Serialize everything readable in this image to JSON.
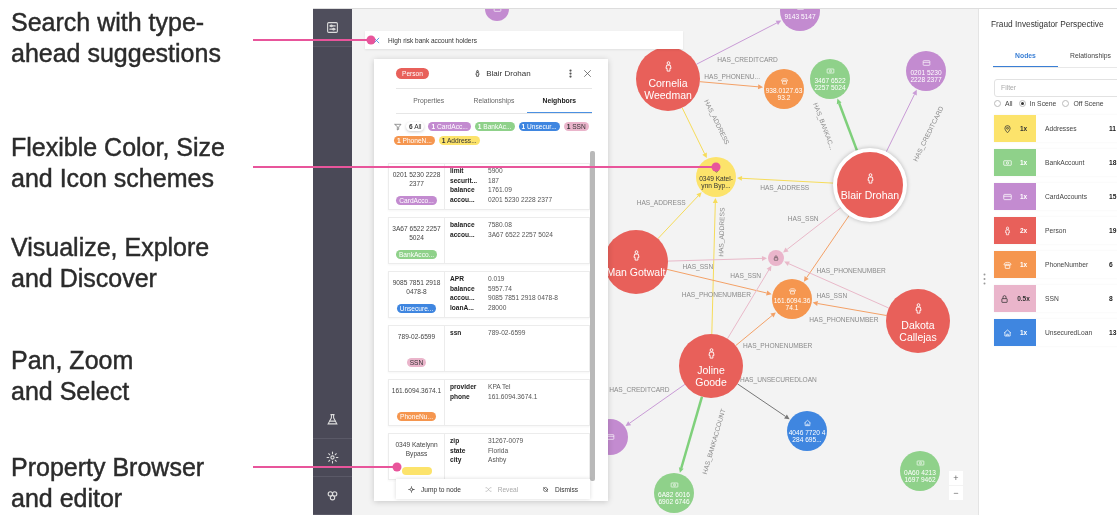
{
  "captions": [
    {
      "lines": [
        "Search with type-",
        "ahead suggestions"
      ],
      "leader": true
    },
    {
      "lines": [
        "Flexible Color, Size",
        "and Icon schemes"
      ],
      "leader": true
    },
    {
      "lines": [
        "Visualize, Explore",
        "and Discover"
      ]
    },
    {
      "lines": [
        "Pan, Zoom",
        "and Select"
      ]
    },
    {
      "lines": [
        "Property Browser",
        "and editor"
      ],
      "leader": true
    }
  ],
  "search": {
    "value": "High risk bank account holders"
  },
  "graph": {
    "nodes": [
      {
        "kind": "person",
        "label": "Cornelia Weedman",
        "focused": false
      },
      {
        "kind": "phone",
        "label": "938.0127.63 93.2",
        "focused": false
      },
      {
        "kind": "bank",
        "label": "3467 6522 2257 5024",
        "focused": false
      },
      {
        "kind": "card",
        "label": "0201 5230 2228 2377",
        "focused": false
      },
      {
        "kind": "address",
        "label": "0349 Katel-ynn Byp...",
        "focused": false
      },
      {
        "kind": "person",
        "label": "Blair Drohan",
        "focused": true
      },
      {
        "kind": "person",
        "label": "Man Gotwalt",
        "focused": false
      },
      {
        "kind": "ssn",
        "focused": false
      },
      {
        "kind": "phone",
        "label": "161.6094.36 74.1",
        "focused": false
      },
      {
        "kind": "person",
        "label": "Dakota Callejas",
        "focused": false
      },
      {
        "kind": "person",
        "label": "Joline Goode",
        "focused": false
      },
      {
        "kind": "card",
        "focused": false
      },
      {
        "kind": "loan",
        "label": "4046 7720 4 284 695...",
        "focused": false
      },
      {
        "kind": "bank",
        "label": "6A82 6016 6902 6746",
        "focused": false
      },
      {
        "kind": "bank",
        "label": "0A60 4213 1697 9462",
        "focused": false
      },
      {
        "kind": "card",
        "label": "9143 5147",
        "focused": false
      },
      {
        "kind": "card",
        "focused": false
      }
    ],
    "edges": [
      {
        "label": "HAS_ADDRESS"
      },
      {
        "label": "HAS_ADDRESS"
      },
      {
        "label": "HAS_ADDRESS"
      },
      {
        "label": "HAS_ADDRESS"
      },
      {
        "label": "HAS_CREDITCARD"
      },
      {
        "label": "HAS_PHONENU..."
      },
      {
        "label": "HAS_BANKAC..."
      },
      {
        "label": "HAS_CREDITCARD"
      },
      {
        "label": "HAS_SSN"
      },
      {
        "label": "HAS_PHONENUMBER"
      },
      {
        "label": "HAS_SSN"
      },
      {
        "label": "HAS_PHONENUMBER"
      },
      {
        "label": "HAS_PHONENUMBER"
      },
      {
        "label": "HAS_SSN"
      },
      {
        "label": "HAS_SSN"
      },
      {
        "label": "HAS_PHONENUMBER"
      },
      {
        "label": "HAS_CREDITCARD"
      },
      {
        "label": "HAS_UNSECUREDLOAN"
      },
      {
        "label": "HAS_BANKACCOUNT"
      }
    ]
  },
  "zoom_controls": [
    "+",
    "−"
  ],
  "detail_panel": {
    "type_badge": "Person",
    "title": "Blair Drohan",
    "tabs": [
      {
        "label": "Properties",
        "selected": false
      },
      {
        "label": "Relationships",
        "selected": false
      },
      {
        "label": "Neighbors",
        "selected": true
      }
    ],
    "filter_chips": [
      {
        "kind": "all",
        "text": "**6** All"
      },
      {
        "kind": "card",
        "text": "**1** CardAcc..."
      },
      {
        "kind": "bank",
        "text": "**1** BankAc..."
      },
      {
        "kind": "loan",
        "text": "**1** Unsecur..."
      },
      {
        "kind": "ssn",
        "text": "**1** SSN"
      },
      {
        "kind": "phone",
        "text": "**1** PhoneN..."
      },
      {
        "kind": "address",
        "text": "**1** Address..."
      }
    ],
    "neighbors": [
      {
        "kind": "card",
        "title": "0201 5230 2228 2377",
        "chip": "CardAcco...",
        "properties": [
          {
            "key": "limit",
            "value": "5900"
          },
          {
            "key": "securit...",
            "value": "187"
          },
          {
            "key": "balance",
            "value": "1761.09"
          },
          {
            "key": "accou...",
            "value": "0201 5230 2228 2377"
          }
        ]
      },
      {
        "kind": "bank",
        "title": "3A67 6522 2257 5024",
        "chip": "BankAcco...",
        "properties": [
          {
            "key": "balance",
            "value": "7580.08"
          },
          {
            "key": "accou...",
            "value": "3A67 6522 2257 5024"
          }
        ]
      },
      {
        "kind": "loan",
        "title": "9085 7851 2918 0478-8",
        "chip": "Unsecure...",
        "properties": [
          {
            "key": "APR",
            "value": "0.019"
          },
          {
            "key": "balance",
            "value": "5957.74"
          },
          {
            "key": "accou...",
            "value": "9085 7851 2918 0478-8"
          },
          {
            "key": "loanA...",
            "value": "28000"
          }
        ]
      },
      {
        "kind": "ssn",
        "title": "789-02-6599",
        "chip": "SSN",
        "properties": [
          {
            "key": "ssn",
            "value": "789-02-6599"
          }
        ]
      },
      {
        "kind": "phone",
        "title": "161.6094.3674.1",
        "chip": "PhoneNu...",
        "properties": [
          {
            "key": "provider",
            "value": "KPA Tel"
          },
          {
            "key": "phone",
            "value": "161.6094.3674.1"
          }
        ]
      },
      {
        "kind": "address",
        "title": "0349 Katelynn Bypass",
        "properties": [
          {
            "key": "zip",
            "value": "31267-0079"
          },
          {
            "key": "state",
            "value": "Florida"
          },
          {
            "key": "city",
            "value": "Ashby"
          }
        ]
      }
    ],
    "actions": [
      {
        "kind": "jump",
        "label": "Jump to node",
        "disabled": false
      },
      {
        "kind": "reveal",
        "label": "Reveal",
        "disabled": true
      },
      {
        "kind": "dismiss",
        "label": "Dismiss",
        "disabled": false
      }
    ]
  },
  "perspective": {
    "title": "Fraud Investigator Perspective",
    "tabs": [
      {
        "label": "Nodes",
        "selected": true
      },
      {
        "label": "Relationships",
        "selected": false
      }
    ],
    "filter": {
      "placeholder": "Filter"
    },
    "scope": [
      {
        "label": "All",
        "selected": false
      },
      {
        "label": "In Scene",
        "selected": true
      },
      {
        "label": "Off Scene",
        "selected": false
      }
    ],
    "categories": [
      {
        "kind": "address",
        "size": "1x",
        "name": "Addresses",
        "count": "11"
      },
      {
        "kind": "bank",
        "size": "1x",
        "name": "BankAccount",
        "count": "18"
      },
      {
        "kind": "card",
        "size": "1x",
        "name": "CardAccounts",
        "count": "15"
      },
      {
        "kind": "person",
        "size": "2x",
        "name": "Person",
        "count": "19"
      },
      {
        "kind": "phone",
        "size": "1x",
        "name": "PhoneNumber",
        "count": "6"
      },
      {
        "kind": "ssn",
        "size": "0.5x",
        "name": "SSN",
        "count": "8"
      },
      {
        "kind": "loan",
        "size": "1x",
        "name": "UnsecuredLoan",
        "count": "13"
      }
    ]
  }
}
